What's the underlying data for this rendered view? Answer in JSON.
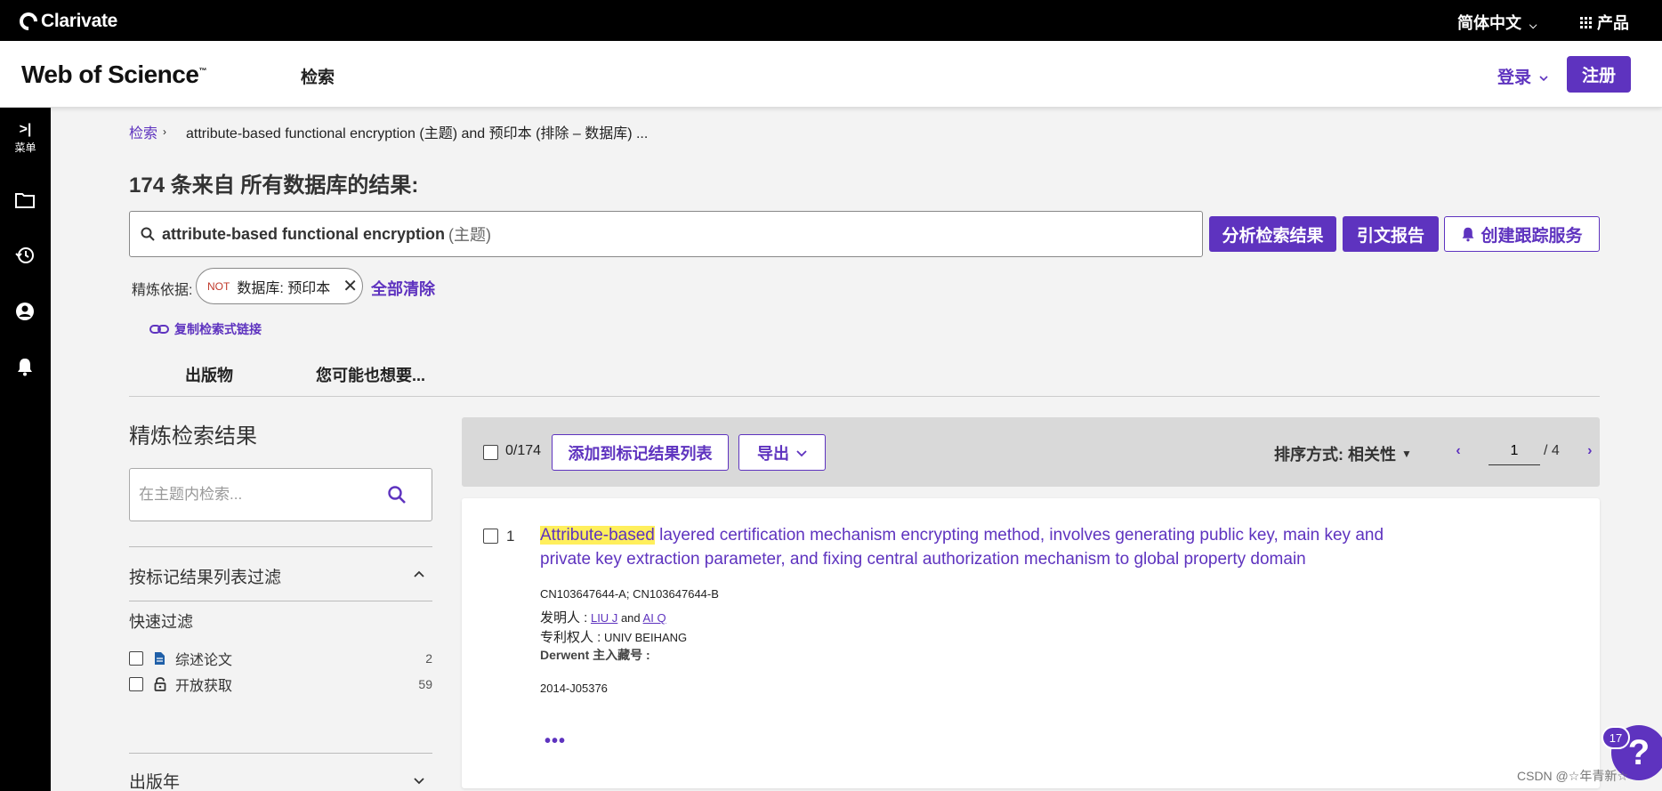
{
  "topbar": {
    "brand": "Clarivate",
    "language": "简体中文",
    "products": "产品"
  },
  "header": {
    "logo": "Web of Science",
    "tm": "™",
    "nav_search": "检索",
    "login": "登录",
    "register": "注册"
  },
  "sidebar": {
    "menu_label": "菜单"
  },
  "breadcrumb": {
    "link": "检索",
    "query": "attribute-based functional encryption (主题) and 预印本 (排除 – 数据库) ..."
  },
  "results": {
    "title": "174 条来自 所有数据库的结果:"
  },
  "query": {
    "text": "attribute-based functional encryption",
    "field": "(主题)"
  },
  "actions": {
    "analyze": "分析检索结果",
    "citation": "引文报告",
    "alert": "创建跟踪服务"
  },
  "refine_by": {
    "label": "精炼依据:",
    "chip_not": "NOT",
    "chip_text": "数据库: 预印本",
    "clear_all": "全部清除"
  },
  "copy_link": "复制检索式链接",
  "tabs": [
    {
      "label": "出版物"
    },
    {
      "label": "您可能也想要..."
    }
  ],
  "refine_panel": {
    "title": "精炼检索结果",
    "search_placeholder": "在主题内检索...",
    "filter_marked": "按标记结果列表过滤",
    "quick_title": "快速过滤",
    "quick_filters": [
      {
        "label": "综述论文",
        "count": "2"
      },
      {
        "label": "开放获取",
        "count": "59"
      }
    ],
    "pub_year": "出版年"
  },
  "toolbar": {
    "selected": "0/174",
    "add_to_marked": "添加到标记结果列表",
    "export": "导出",
    "sort_label": "排序方式: 相关性",
    "page": "1",
    "total_pages": "/ 4"
  },
  "result": {
    "number": "1",
    "title_highlight": "Attribute-based",
    "title_rest": " layered certification mechanism encrypting method, involves generating public key, main key and private key extraction parameter, and fixing central authorization mechanism to global property domain",
    "patent_no": "CN103647644-A; CN103647644-B",
    "inventor_label": "发明人 :",
    "inventor_1": "LIU J",
    "and": "and",
    "inventor_2": "AI Q",
    "assignee_label": "专利权人 :",
    "assignee": "UNIV BEIHANG",
    "derwent_label": "Derwent 主入藏号 :",
    "derwent_no": "2014-J05376",
    "more": "•••"
  },
  "help": {
    "badge": "17",
    "icon": "?"
  },
  "watermark": "CSDN @☆年青新☆",
  "colors": {
    "accent": "#5e33bf",
    "highlight": "#ffef5c",
    "topbar": "#000000"
  }
}
